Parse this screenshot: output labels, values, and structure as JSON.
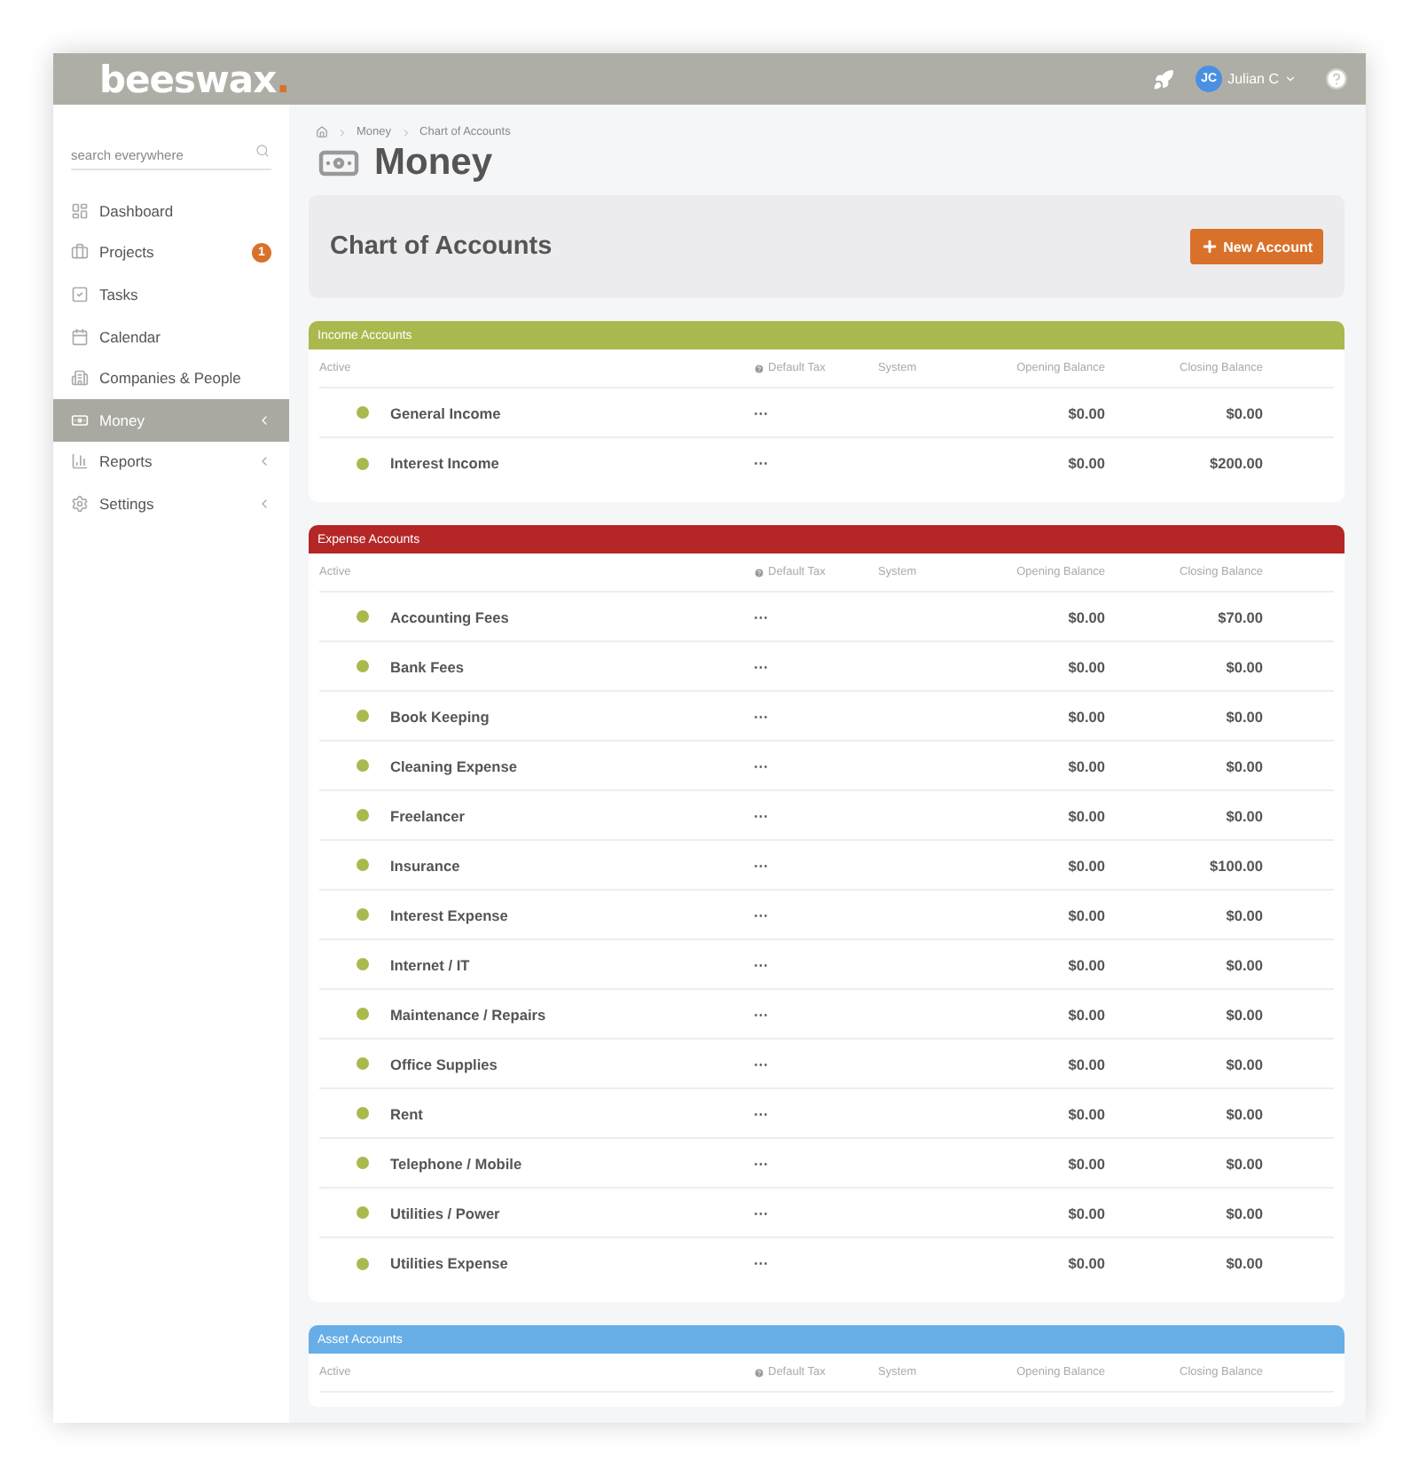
{
  "logo": "beeswax",
  "logo_dot": ".",
  "user": {
    "initials": "JC",
    "name": "Julian C"
  },
  "search": {
    "placeholder": "search everywhere"
  },
  "sidebar": {
    "items": [
      {
        "label": "Dashboard",
        "selected": false
      },
      {
        "label": "Projects",
        "selected": false,
        "badge": "1"
      },
      {
        "label": "Tasks",
        "selected": false
      },
      {
        "label": "Calendar",
        "selected": false
      },
      {
        "label": "Companies & People",
        "selected": false
      },
      {
        "label": "Money",
        "selected": true,
        "expandable": true
      },
      {
        "label": "Reports",
        "selected": false,
        "expandable": true
      },
      {
        "label": "Settings",
        "selected": false,
        "expandable": true
      }
    ]
  },
  "breadcrumb": [
    "Money",
    "Chart of Accounts"
  ],
  "page_title": "Money",
  "header": {
    "title": "Chart of Accounts",
    "button": "New Account"
  },
  "sections": [
    {
      "title": "Income Accounts",
      "color": "#abb84e",
      "columns": [
        "Active",
        "Default Tax",
        "System",
        "Opening Balance",
        "Closing Balance"
      ],
      "rows": [
        {
          "name": "General Income",
          "active": true,
          "tax": "···",
          "opening": "$0.00",
          "closing": "$0.00"
        },
        {
          "name": "Interest Income",
          "active": true,
          "tax": "···",
          "opening": "$0.00",
          "closing": "$200.00"
        }
      ]
    },
    {
      "title": "Expense Accounts",
      "color": "#b52626",
      "columns": [
        "Active",
        "Default Tax",
        "System",
        "Opening Balance",
        "Closing Balance"
      ],
      "rows": [
        {
          "name": "Accounting Fees",
          "active": true,
          "tax": "···",
          "opening": "$0.00",
          "closing": "$70.00"
        },
        {
          "name": "Bank Fees",
          "active": true,
          "tax": "···",
          "opening": "$0.00",
          "closing": "$0.00"
        },
        {
          "name": "Book Keeping",
          "active": true,
          "tax": "···",
          "opening": "$0.00",
          "closing": "$0.00"
        },
        {
          "name": "Cleaning Expense",
          "active": true,
          "tax": "···",
          "opening": "$0.00",
          "closing": "$0.00"
        },
        {
          "name": "Freelancer",
          "active": true,
          "tax": "···",
          "opening": "$0.00",
          "closing": "$0.00"
        },
        {
          "name": "Insurance",
          "active": true,
          "tax": "···",
          "opening": "$0.00",
          "closing": "$100.00"
        },
        {
          "name": "Interest Expense",
          "active": true,
          "tax": "···",
          "opening": "$0.00",
          "closing": "$0.00"
        },
        {
          "name": "Internet / IT",
          "active": true,
          "tax": "···",
          "opening": "$0.00",
          "closing": "$0.00"
        },
        {
          "name": "Maintenance / Repairs",
          "active": true,
          "tax": "···",
          "opening": "$0.00",
          "closing": "$0.00"
        },
        {
          "name": "Office Supplies",
          "active": true,
          "tax": "···",
          "opening": "$0.00",
          "closing": "$0.00"
        },
        {
          "name": "Rent",
          "active": true,
          "tax": "···",
          "opening": "$0.00",
          "closing": "$0.00"
        },
        {
          "name": "Telephone / Mobile",
          "active": true,
          "tax": "···",
          "opening": "$0.00",
          "closing": "$0.00"
        },
        {
          "name": "Utilities / Power",
          "active": true,
          "tax": "···",
          "opening": "$0.00",
          "closing": "$0.00"
        },
        {
          "name": "Utilities Expense",
          "active": true,
          "tax": "···",
          "opening": "$0.00",
          "closing": "$0.00"
        }
      ]
    },
    {
      "title": "Asset Accounts",
      "color": "#68aee6",
      "columns": [
        "Active",
        "Default Tax",
        "System",
        "Opening Balance",
        "Closing Balance"
      ]
    }
  ]
}
